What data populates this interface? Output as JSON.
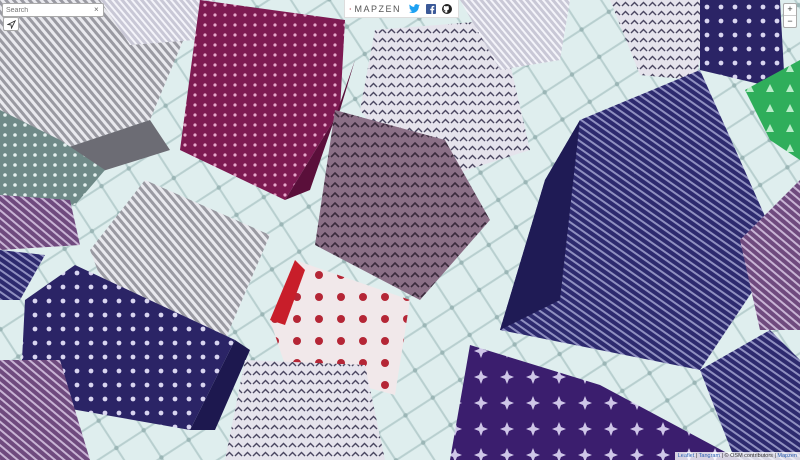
{
  "search": {
    "placeholder": "Search",
    "clear_glyph": "×"
  },
  "locate": {
    "icon": "locate-arrow-icon"
  },
  "brand": {
    "name": "MAPZEN",
    "logo": "mapzen-logo-icon",
    "social": [
      "twitter-icon",
      "facebook-icon",
      "github-icon"
    ]
  },
  "zoom": {
    "in_label": "+",
    "out_label": "−"
  },
  "attribution": {
    "leaflet": "Leaflet",
    "sep1": " | ",
    "tangram": "Tangram",
    "osm": " | © OSM contributors",
    "mapzen_sep": " | ",
    "mapzen": "Mapzen"
  },
  "colors": {
    "ground": "#dfeeee",
    "plum": "#7d1a52",
    "navy": "#2d2a6e",
    "grey": "#8f8f96",
    "red": "#c81e2a",
    "green": "#2fae5b",
    "mauve": "#8a6f86",
    "brand_red": "#d9363e"
  }
}
